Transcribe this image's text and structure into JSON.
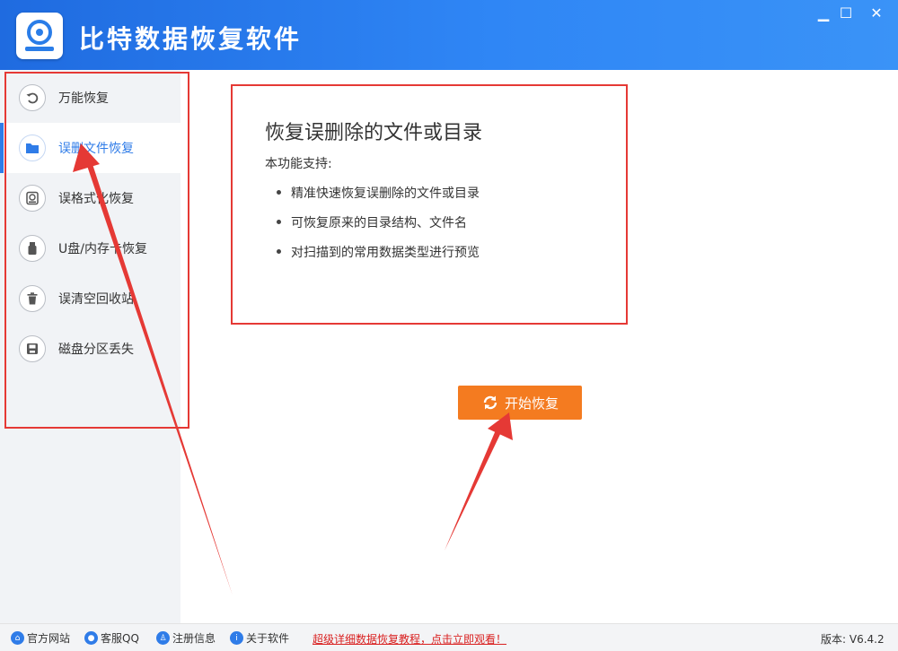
{
  "app": {
    "title": "比特数据恢复软件",
    "window_controls": {
      "minimize": "▁",
      "maximize": "☐",
      "close": "✕"
    }
  },
  "sidebar": {
    "items": [
      {
        "label": "万能恢复",
        "icon": "undo-icon",
        "glyph": "↺"
      },
      {
        "label": "误删文件恢复",
        "icon": "folder-icon",
        "glyph": ""
      },
      {
        "label": "误格式化恢复",
        "icon": "restore-disk-icon",
        "glyph": "↻"
      },
      {
        "label": "U盘/内存卡恢复",
        "icon": "usb-icon",
        "glyph": "▮"
      },
      {
        "label": "误清空回收站",
        "icon": "trash-icon",
        "glyph": "🗑"
      },
      {
        "label": "磁盘分区丢失",
        "icon": "disk-icon",
        "glyph": "▣"
      }
    ],
    "active_index": 1
  },
  "panel": {
    "title": "恢复误删除的文件或目录",
    "subtitle": "本功能支持:",
    "features": [
      "精准快速恢复误删除的文件或目录",
      "可恢复原来的目录结构、文件名",
      "对扫描到的常用数据类型进行预览"
    ]
  },
  "start_button": {
    "label": "开始恢复",
    "icon": "refresh-icon"
  },
  "statusbar": {
    "links": [
      {
        "label": "官方网站",
        "icon": "home-icon"
      },
      {
        "label": "客服QQ",
        "icon": "qq-icon"
      },
      {
        "label": "注册信息",
        "icon": "user-icon"
      },
      {
        "label": "关于软件",
        "icon": "info-icon"
      }
    ],
    "promo": "超级详细数据恢复教程，点击立即观看！",
    "version": "版本: V6.4.2"
  },
  "colors": {
    "title_bar": "#2f86f5",
    "accent": "#2f7ce8",
    "start_button": "#f47b20",
    "annotation": "#e53935"
  }
}
